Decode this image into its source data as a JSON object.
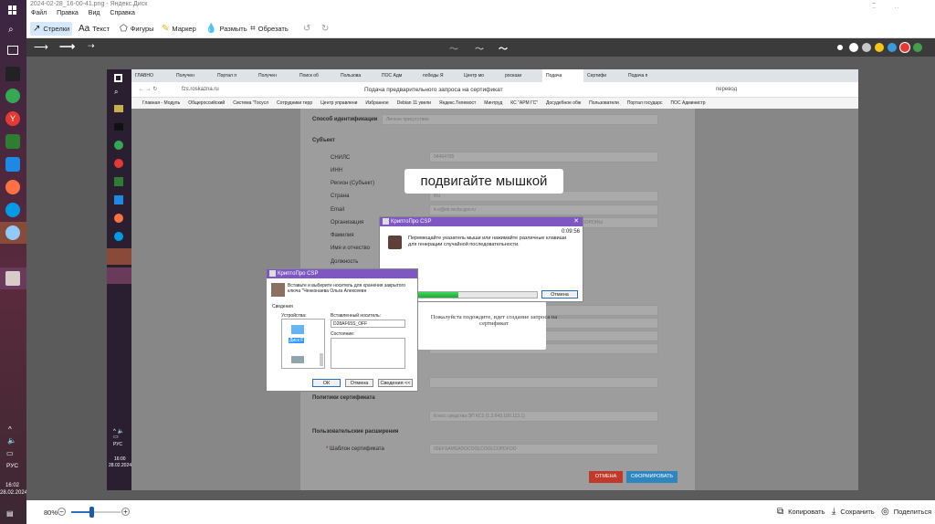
{
  "window": {
    "title": "2024-02-28_16-00-41.png - Яндекс.Диск"
  },
  "menu": [
    "Файл",
    "Правка",
    "Вид",
    "Справка"
  ],
  "tools": {
    "arrows": "Стрелки",
    "text": "Текст",
    "shapes": "Фигуры",
    "marker": "Маркер",
    "blur": "Размыть",
    "crop": "Обрезать"
  },
  "colors": [
    "#ffffff",
    "#c8c8c8",
    "#f5c518",
    "#3a9bdc",
    "#e53935",
    "#43a047"
  ],
  "browser": {
    "tabs": [
      "ГЛАВНО",
      "Получен",
      "Портал п",
      "Получен",
      "Поиск об",
      "Пользова",
      "ПОС Адм",
      "победы Я",
      "Центр мо",
      "роскази",
      "Подача",
      "Сертифи",
      "Подача п"
    ],
    "url": "fzs.roskazna.ru",
    "page_title": "Подача предварительного запроса на сертификат",
    "translate": "перевод",
    "bookmarks": [
      "Главная - Модуль",
      "Общероссийский",
      "Система \"Госусл",
      "Сотрудники терр",
      "Центр управлени",
      "Избранное",
      "Debian 11 увели",
      "Яндекс.Телемост",
      "Минтруд",
      "КС \"АРМ ГС\"",
      "Досудебное обж",
      "Пользователи",
      "Портал государс",
      "ПОС Администр"
    ]
  },
  "form": {
    "id_method_label": "Способ идентификации",
    "id_method_value": "Личное присутствие",
    "subject": "Субъект",
    "fields": [
      "СНИЛС",
      "ИНН",
      "Регион (Субъект)",
      "Страна",
      "Email",
      "Организация",
      "Фамилия",
      "Имя и отчество",
      "Должность"
    ],
    "values": {
      "snils": "04464705",
      "country": "RU",
      "email": "it-e@ek.rechs.gov.ru",
      "org": "ГЛАВНОЕ УПРАВЛЕНИЕ МЧС РОССИИ ... ДЕЛАМ ГРАЖДАНСКОЙ ОБОРОНЫ"
    },
    "policies": "Политики сертификата",
    "policy_value": "Класс средства ЭП КС1 (1.2.643.100.113.1)",
    "ext": "Пользовательские расширения",
    "template_label": "Шаблон сертификата",
    "template_value": "00EFSAMSADOCOOLCOOLCOPDFOO",
    "wait": "Пожалуйста подождите, идет создание запроса на сертификат",
    "cancel": "ОТМЕНА",
    "submit": "СФОРМИРОВАТЬ"
  },
  "overlay": "подвигайте мышкой",
  "csp1": {
    "title": "КриптоПро CSP",
    "timer": "0:09:56",
    "msg": "Перемещайте указатель мыши или нажимайте различные клавиши для генерации случайной последовательности.",
    "cancel": "Отмена",
    "progress": 0.47
  },
  "csp2": {
    "title": "КриптоПро CSP",
    "msg": "Вставьте и выберите носитель для хранения закрытого ключа \"Ченконаева Ольга Алексеевн",
    "info": "Сведения",
    "devices": "Устройства:",
    "inserted": "Вставленный носитель:",
    "media": "D28AF65S_OFF",
    "state": "Состояние:",
    "disk": "Диск F",
    "ok": "ОК",
    "cancel": "Отмена",
    "details": "Сведения <<"
  },
  "inner_tray": {
    "time": "16:00",
    "date": "28.02.2024",
    "lang": "РУС"
  },
  "outer_tray": {
    "time": "16:02",
    "date": "28.02.2024",
    "lang": "РУС"
  },
  "status": {
    "zoom": "80%",
    "copy": "Копировать",
    "save": "Сохранить",
    "share": "Поделиться",
    "zoom_level": 0.4
  }
}
